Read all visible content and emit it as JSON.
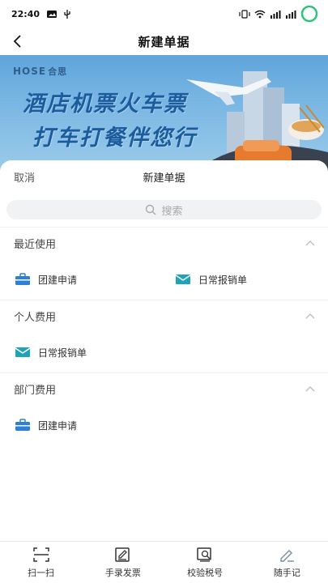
{
  "status_bar": {
    "time": "22:40",
    "icons_left": [
      "image-notification-icon",
      "usb-icon"
    ],
    "icons_right": [
      "vibrate-icon",
      "wifi-icon",
      "signal-icon",
      "signal-icon",
      "battery-ring-icon"
    ]
  },
  "nav": {
    "title": "新建单据",
    "back_icon": "chevron-left-icon"
  },
  "banner": {
    "brand": "HOSE",
    "brand_suffix": "合思",
    "line1": "酒店机票火车票",
    "line2": "打车打餐伴您行"
  },
  "sheet": {
    "cancel_label": "取消",
    "title": "新建单据",
    "search_placeholder": "搜索",
    "groups": [
      {
        "title": "最近使用",
        "items": [
          {
            "label": "团建申请",
            "icon": "briefcase-icon"
          },
          {
            "label": "日常报销单",
            "icon": "envelope-icon"
          }
        ]
      },
      {
        "title": "个人费用",
        "items": [
          {
            "label": "日常报销单",
            "icon": "envelope-icon"
          }
        ]
      },
      {
        "title": "部门费用",
        "items": [
          {
            "label": "团建申请",
            "icon": "briefcase-icon"
          }
        ]
      }
    ]
  },
  "tabbar": [
    {
      "label": "扫一扫",
      "icon": "scan-icon"
    },
    {
      "label": "手录发票",
      "icon": "manual-invoice-icon"
    },
    {
      "label": "校验税号",
      "icon": "verify-tax-icon"
    },
    {
      "label": "随手记",
      "icon": "pen-note-icon"
    }
  ],
  "colors": {
    "briefcase": "#2e7fd6",
    "envelope": "#1fa3b8",
    "banner_text": "#1b5c9e"
  }
}
